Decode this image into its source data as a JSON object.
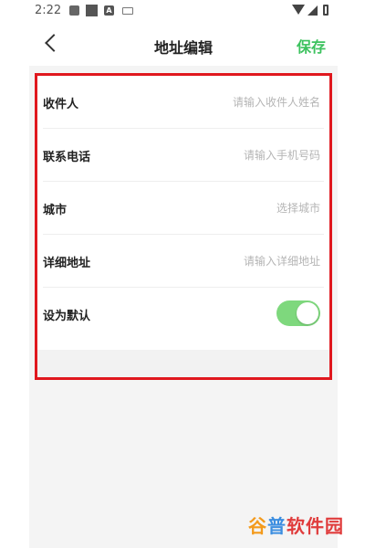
{
  "status_bar": {
    "time": "2:22",
    "icons": [
      "photo-icon",
      "square-icon",
      "a-icon",
      "keyboard-icon",
      "wifi-icon",
      "signal-icon",
      "battery-icon"
    ]
  },
  "header": {
    "back_icon": "chevron-left-icon",
    "title": "地址编辑",
    "save_label": "保存"
  },
  "form": {
    "rows": [
      {
        "label": "收件人",
        "value": "",
        "placeholder": "请输入收件人姓名"
      },
      {
        "label": "联系电话",
        "value": "",
        "placeholder": "请输入手机号码"
      },
      {
        "label": "城市",
        "value": "",
        "placeholder": "选择城市"
      },
      {
        "label": "详细地址",
        "value": "",
        "placeholder": "请输入详细地址"
      }
    ],
    "default_label": "设为默认",
    "default_on": true
  },
  "colors": {
    "accent": "#3cc25e",
    "toggle_on": "#7ed87d",
    "highlight_border": "#e0181e"
  },
  "watermark": {
    "part1": "谷",
    "part2": "普",
    "part3": "软件园"
  }
}
